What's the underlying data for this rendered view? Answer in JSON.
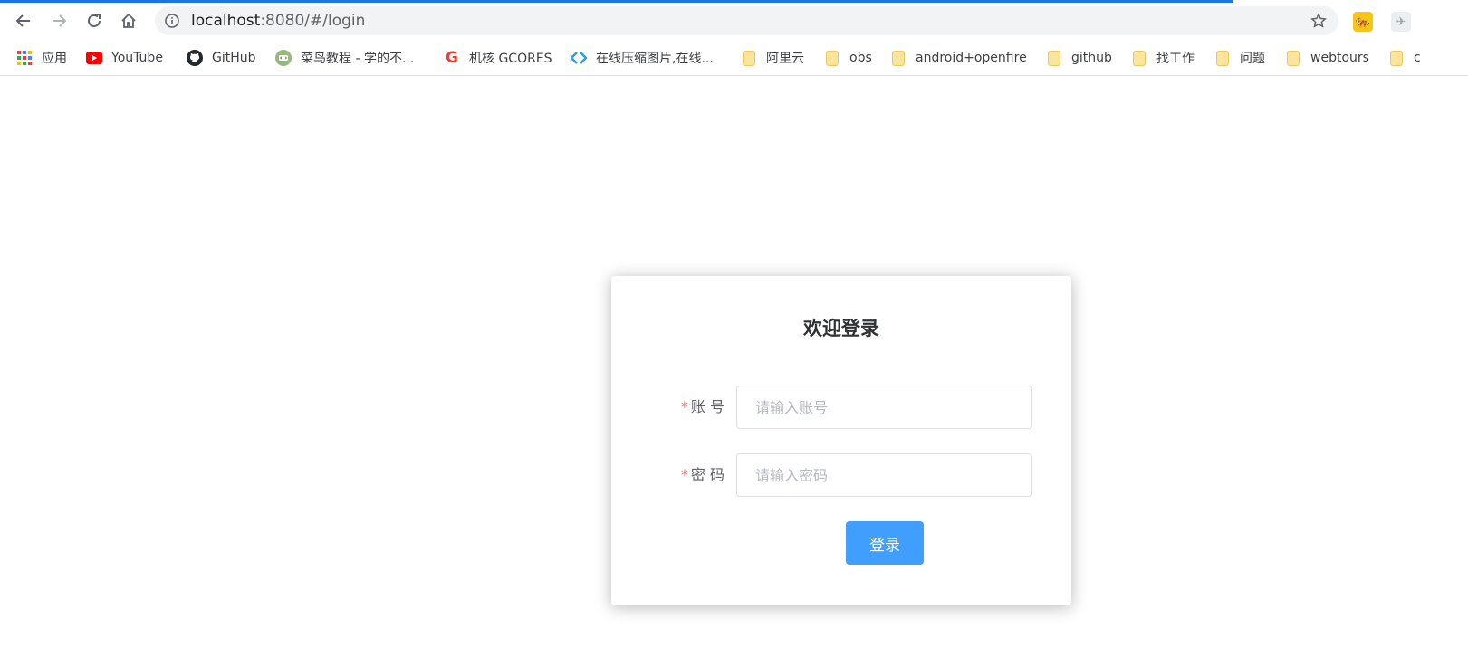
{
  "browser": {
    "url_host": "localhost",
    "url_path": ":8080/#/login",
    "progress_percent": 84
  },
  "bookmarks": [
    {
      "label": "应用",
      "icon": "apps-grid-icon"
    },
    {
      "label": "YouTube",
      "icon": "youtube-icon"
    },
    {
      "label": "GitHub",
      "icon": "github-icon"
    },
    {
      "label": "菜鸟教程 - 学的不...",
      "icon": "runoob-icon"
    },
    {
      "label": "机核 GCORES",
      "icon": "gcores-icon"
    },
    {
      "label": "在线压缩图片,在线...",
      "icon": "compress-icon"
    },
    {
      "label": "阿里云",
      "icon": "folder-icon"
    },
    {
      "label": "obs",
      "icon": "folder-icon"
    },
    {
      "label": "android+openfire",
      "icon": "folder-icon"
    },
    {
      "label": "github",
      "icon": "folder-icon"
    },
    {
      "label": "找工作",
      "icon": "folder-icon"
    },
    {
      "label": "问题",
      "icon": "folder-icon"
    },
    {
      "label": "webtours",
      "icon": "folder-icon"
    },
    {
      "label": "c",
      "icon": "folder-icon"
    }
  ],
  "login": {
    "title": "欢迎登录",
    "required_mark": "*",
    "account_label": "账 号",
    "account_placeholder": "请输入账号",
    "password_label": "密 码",
    "password_placeholder": "请输入密码",
    "submit_label": "登录"
  },
  "colors": {
    "primary": "#409eff",
    "required": "#f56c6c",
    "progress": "#1a73e8"
  }
}
